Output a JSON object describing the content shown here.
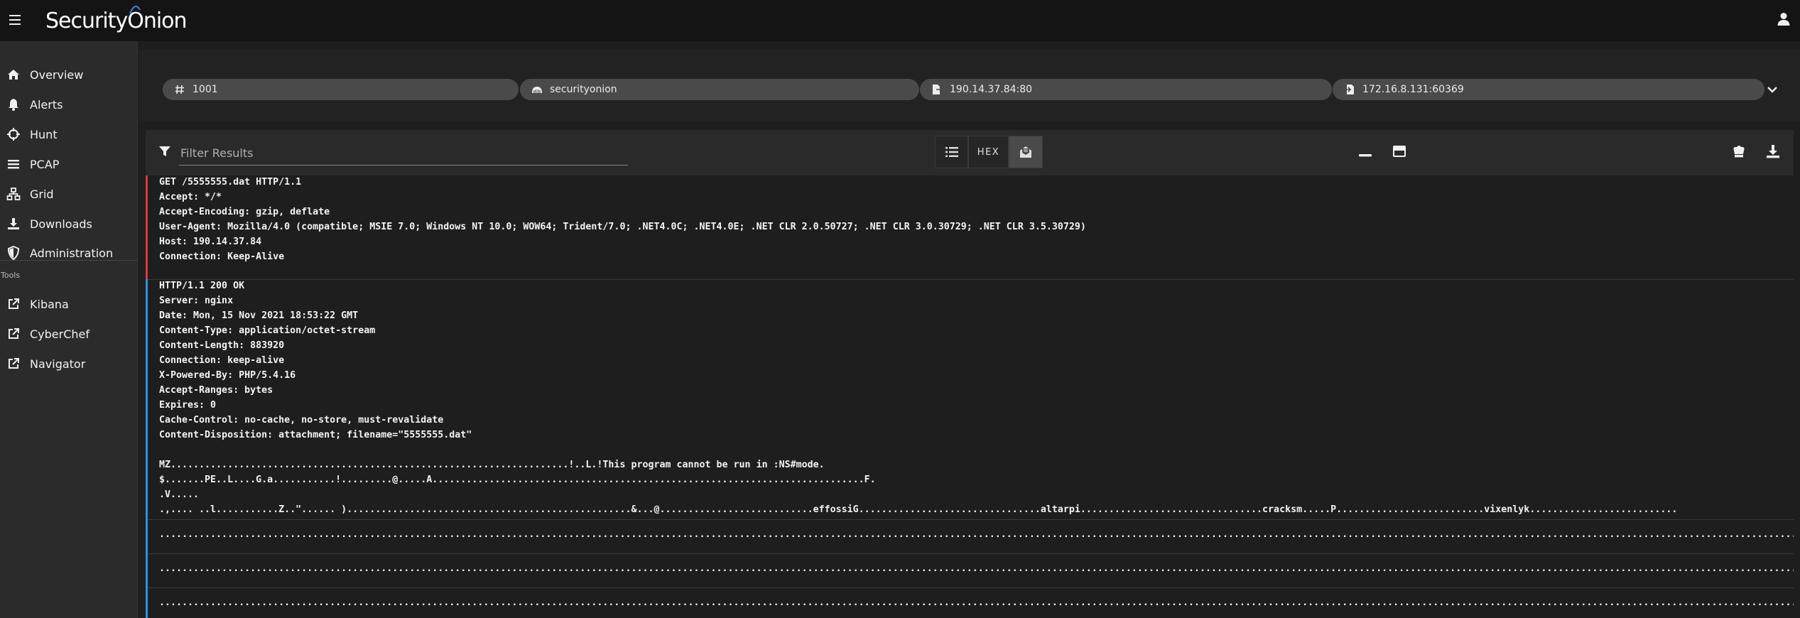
{
  "app": {
    "brand_prefix": "Security",
    "brand_suffix": "nion"
  },
  "sidebar": {
    "items": [
      {
        "label": "Overview",
        "icon": "home-icon"
      },
      {
        "label": "Alerts",
        "icon": "bell-icon"
      },
      {
        "label": "Hunt",
        "icon": "crosshairs-icon"
      },
      {
        "label": "PCAP",
        "icon": "bars-icon"
      },
      {
        "label": "Grid",
        "icon": "sitemap-icon"
      },
      {
        "label": "Downloads",
        "icon": "download-icon"
      },
      {
        "label": "Administration",
        "icon": "shield-icon"
      }
    ],
    "tools_label": "Tools",
    "tools": [
      {
        "label": "Kibana",
        "icon": "external-link-icon"
      },
      {
        "label": "CyberChef",
        "icon": "external-link-icon"
      },
      {
        "label": "Navigator",
        "icon": "external-link-icon"
      }
    ]
  },
  "chips": [
    {
      "label": "1001",
      "icon": "hash-icon"
    },
    {
      "label": "securityonion",
      "icon": "sensor-icon"
    },
    {
      "label": "190.14.37.84:80",
      "icon": "source-file-icon"
    },
    {
      "label": "172.16.8.131:60369",
      "icon": "destination-file-icon"
    }
  ],
  "toolbar": {
    "filter_placeholder": "Filter Results",
    "hex_label": "HEX"
  },
  "colors": {
    "request_bar": "#d9393e",
    "response_bar": "#2f8fe0",
    "accent": "#3a7bd5"
  },
  "request_lines": [
    "GET /5555555.dat HTTP/1.1",
    "Accept: */*",
    "Accept-Encoding: gzip, deflate",
    "User-Agent: Mozilla/4.0 (compatible; MSIE 7.0; Windows NT 10.0; WOW64; Trident/7.0; .NET4.0C; .NET4.0E; .NET CLR 2.0.50727; .NET CLR 3.0.30729; .NET CLR 3.5.30729)",
    "Host: 190.14.37.84",
    "Connection: Keep-Alive"
  ],
  "response_lines": [
    "HTTP/1.1 200 OK",
    "Server: nginx",
    "Date: Mon, 15 Nov 2021 18:53:22 GMT",
    "Content-Type: application/octet-stream",
    "Content-Length: 883920",
    "Connection: keep-alive",
    "X-Powered-By: PHP/5.4.16",
    "Accept-Ranges: bytes",
    "Expires: 0",
    "Cache-Control: no-cache, no-store, must-revalidate",
    "Content-Disposition: attachment; filename=\"5555555.dat\"",
    "",
    "MZ......................................................................!..L.!This program cannot be run in :NS#mode.",
    "$.......PE..L....G.a...........!.........@.....A............................................................................F.",
    ".V.....",
    ".,.... ..l...........Z..\"...... )..................................................&...@...........................effossiG................................altarpi................................cracksm.....P..........................vixenlyk.........................."
  ],
  "payload_lines": [
    "..............................................................................................................................................................................................................................................................................................................................",
    "..............................................................................................................................................................................................................................................................................................................................",
    ".............................................................................................................................................................................................................................................................................................................................."
  ]
}
